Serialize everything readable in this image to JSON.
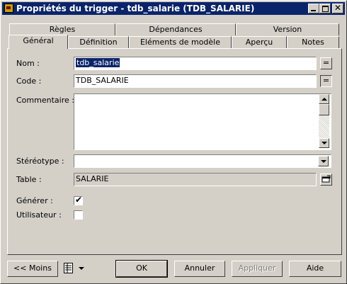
{
  "window": {
    "title": "Propriétés du trigger - tdb_salarie (TDB_SALARIE)"
  },
  "tabs_back": [
    "Règles",
    "Dépendances",
    "Version"
  ],
  "tabs_front": [
    "Général",
    "Définition",
    "Eléments de modèle",
    "Aperçu",
    "Notes"
  ],
  "form": {
    "nom_label": "Nom :",
    "nom_value": "tdb_salarie",
    "code_label": "Code :",
    "code_value": "TDB_SALARIE",
    "eq_label": "=",
    "commentaire_label": "Commentaire :",
    "commentaire_value": "",
    "stereotype_label": "Stéréotype :",
    "stereotype_value": "",
    "table_label": "Table :",
    "table_value": "SALARIE",
    "generer_label": "Générer :",
    "generer_checked": true,
    "utilisateur_label": "Utilisateur :",
    "utilisateur_checked": false,
    "check_mark": "✔"
  },
  "buttons": {
    "moins": "<< Moins",
    "ok": "OK",
    "annuler": "Annuler",
    "appliquer": "Appliquer",
    "aide": "Aide"
  },
  "icons": {
    "app": "trigger-app-icon",
    "properties": "properties-list-icon",
    "browse": "browse-object-icon"
  }
}
